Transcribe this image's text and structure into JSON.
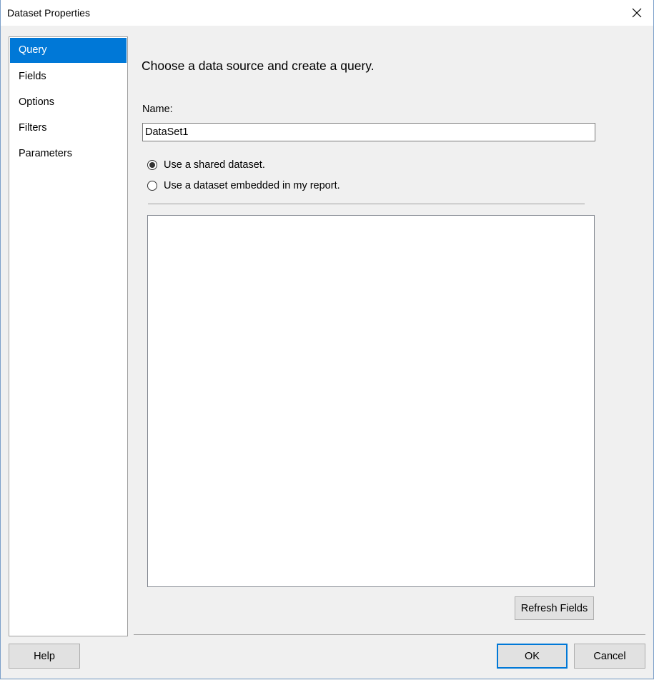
{
  "window": {
    "title": "Dataset Properties"
  },
  "nav": {
    "items": [
      {
        "label": "Query",
        "selected": true
      },
      {
        "label": "Fields",
        "selected": false
      },
      {
        "label": "Options",
        "selected": false
      },
      {
        "label": "Filters",
        "selected": false
      },
      {
        "label": "Parameters",
        "selected": false
      }
    ]
  },
  "main": {
    "heading": "Choose a data source and create a query.",
    "name_label": "Name:",
    "name_value": "DataSet1",
    "radio_shared_label": "Use a shared dataset.",
    "radio_embedded_label": "Use a dataset embedded in my report.",
    "radio_selected": "shared",
    "refresh_button_label": "Refresh Fields"
  },
  "footer": {
    "help_label": "Help",
    "ok_label": "OK",
    "cancel_label": "Cancel"
  },
  "colors": {
    "accent": "#0078d7",
    "background": "#f0f0f0"
  }
}
